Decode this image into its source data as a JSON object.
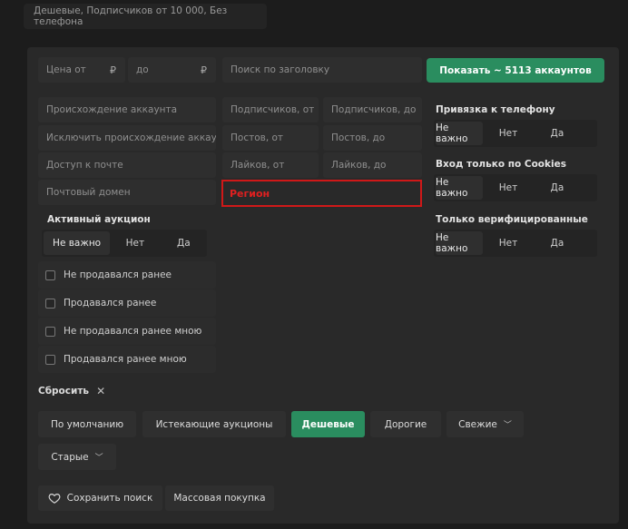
{
  "saved_filter": "Дешевые, Подписчиков от 10 000, Без телефона",
  "price": {
    "from_placeholder": "Цена от",
    "to_placeholder": "до",
    "currency": "₽"
  },
  "title_search_placeholder": "Поиск по заголовку",
  "show_button": "Показать ~ 5113 аккаунтов",
  "left_fields": [
    "Происхождение аккаунта",
    "Исключить происхождение аккаунт",
    "Доступ к почте",
    "Почтовый домен"
  ],
  "mid_fields": {
    "subs_from": "Подписчиков, от",
    "subs_to": "Подписчиков, до",
    "posts_from": "Постов, от",
    "posts_to": "Постов, до",
    "likes_from": "Лайков, от",
    "likes_to": "Лайков, до"
  },
  "region_label": "Регион",
  "toggle_options": [
    "Не важно",
    "Нет",
    "Да"
  ],
  "phone_binding_label": "Привязка к телефону",
  "cookies_label": "Вход только по Cookies",
  "verified_label": "Только верифицированные",
  "auction_label": "Активный аукцион",
  "checkboxes": [
    "Не продавался ранее",
    "Продавался ранее",
    "Не продавался ранее мною",
    "Продавался ранее мною"
  ],
  "reset_label": "Сбросить",
  "sort_buttons": [
    "По умолчанию",
    "Истекающие аукционы",
    "Дешевые",
    "Дорогие",
    "Свежие",
    "Старые"
  ],
  "save_search": "Сохранить поиск",
  "bulk_buy": "Массовая покупка",
  "colors": {
    "accent": "#2a8d5f",
    "highlight": "#d01818"
  }
}
